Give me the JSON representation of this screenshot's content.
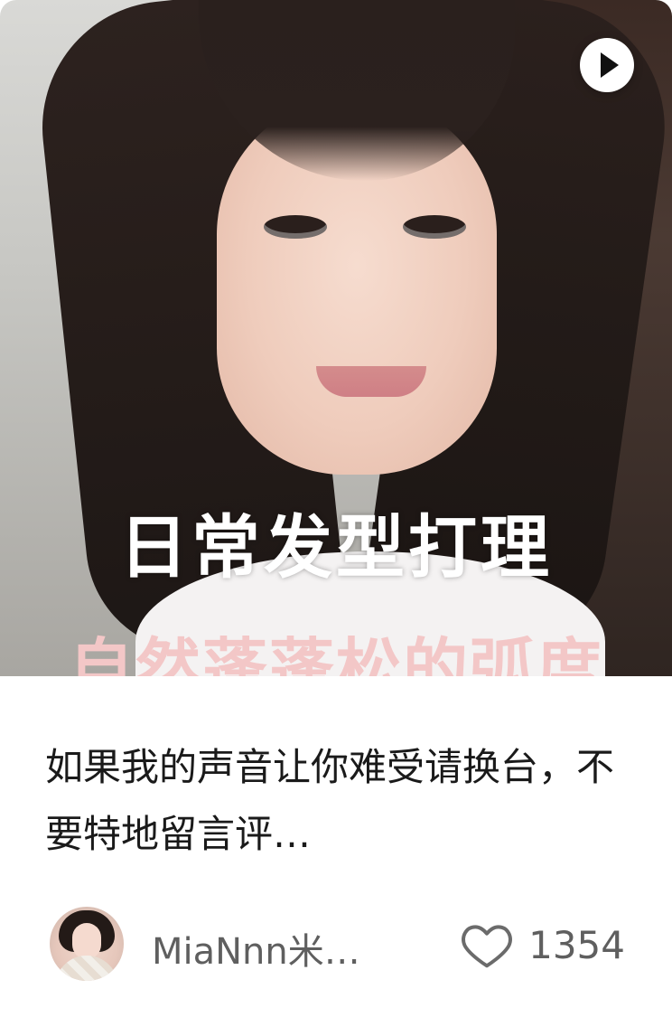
{
  "card": {
    "cover": {
      "play_icon": "play-icon",
      "overlay_line1": "日常发型打理",
      "overlay_line2": "自然蓬蓬松的弧度"
    },
    "title": "如果我的声音让你难受请换台，不要特地留言评…",
    "author": {
      "name": "MiaNnn米…"
    },
    "likes": {
      "icon": "heart-outline-icon",
      "count": "1354"
    }
  }
}
